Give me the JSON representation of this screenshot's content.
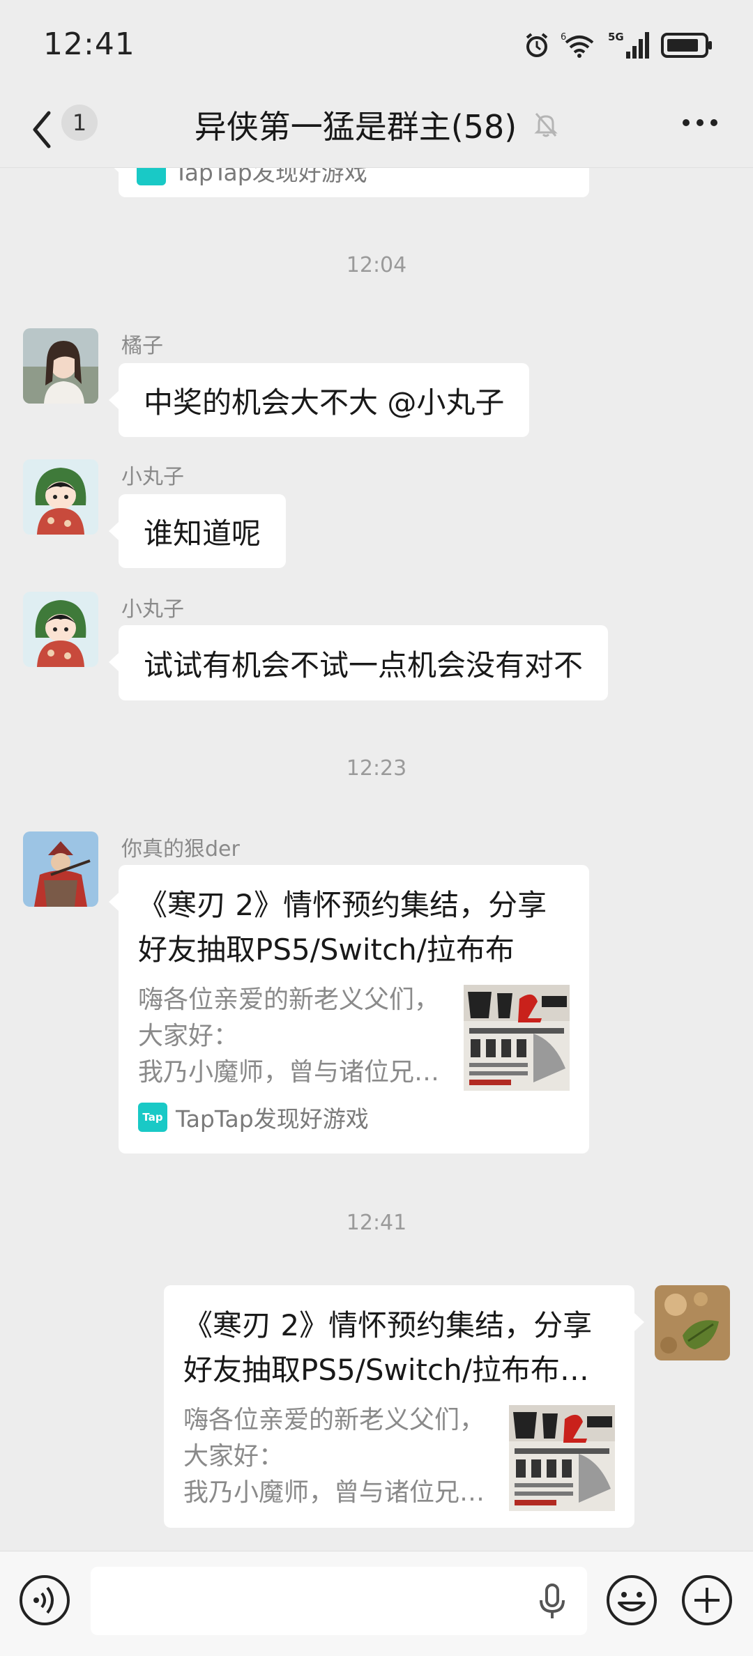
{
  "status_bar": {
    "time": "12:41",
    "network_label": "5G",
    "wifi_superscript": "6"
  },
  "header": {
    "unread_count": "1",
    "title": "异侠第一猛是群主(58)"
  },
  "top_card": {
    "source": "TapTap发现好游戏"
  },
  "timestamps": [
    "12:04",
    "12:23",
    "12:41"
  ],
  "messages": [
    {
      "sender": "橘子",
      "text": "中奖的机会大不大 @小丸子"
    },
    {
      "sender": "小丸子",
      "text": "谁知道呢"
    },
    {
      "sender": "小丸子",
      "text": "试试有机会不试一点机会没有对不"
    }
  ],
  "shared_card_1": {
    "sender": "你真的狠der",
    "title_line1": "《寒刃 2》情怀预约集结，分享",
    "title_line2": "好友抽取PS5/Switch/拉布布",
    "desc_line1": "嗨各位亲爱的新老义父们，",
    "desc_line2": "大家好：",
    "desc_line3": "我乃小魔师，曾与诸位兄…",
    "source_icon_text": "Tap",
    "source": "TapTap发现好游戏"
  },
  "shared_card_2": {
    "title_line1": "《寒刃 2》情怀预约集结，分享",
    "title_line2": "好友抽取PS5/Switch/拉布布…",
    "desc_line1": "嗨各位亲爱的新老义父们，",
    "desc_line2": "大家好：",
    "desc_line3": "我乃小魔师，曾与诸位兄…"
  },
  "input": {
    "placeholder": ""
  },
  "icons": {
    "back": "chevron-left-icon",
    "mute": "bell-off-icon",
    "more": "more-dots-icon",
    "voice": "voice-icon",
    "mic": "microphone-icon",
    "emoji": "emoji-icon",
    "plus": "plus-icon"
  },
  "colors": {
    "background": "#ededed",
    "bubble": "#ffffff",
    "taptap": "#19c9c6"
  }
}
